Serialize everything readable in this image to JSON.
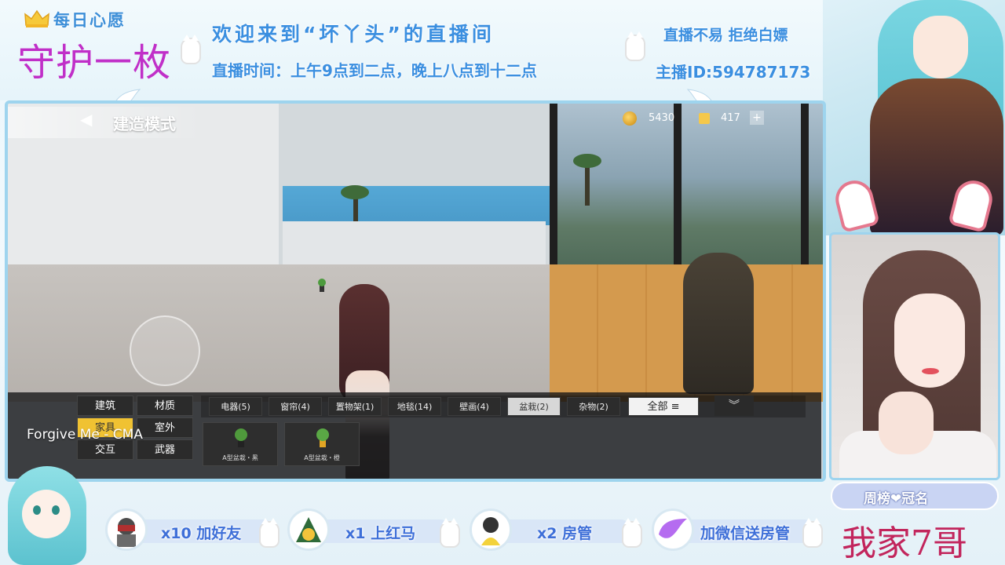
{
  "overlay": {
    "wish_title": "每日心愿",
    "wish_value": "守护一枚",
    "welcome": "欢迎来到“坏丫头”的直播间",
    "schedule": "直播时间：上午9点到二点，晚上八点到十二点",
    "motto": "直播不易 拒绝白嫖",
    "streamer_id": "主播ID:594787173",
    "ranking_label": "周榜❤冠名",
    "sponsor": "我家7哥",
    "music_overlay": "Forgive Me - CMA"
  },
  "game": {
    "mode_title": "建造模式",
    "coins": "5430",
    "tickets": "417",
    "add_symbol": "+",
    "categories": [
      "建筑",
      "材质",
      "家具",
      "室外",
      "交互",
      "武器"
    ],
    "active_category": "家具",
    "sub_tabs": [
      "电器(5)",
      "窗帘(4)",
      "置物架(1)",
      "地毯(14)",
      "壁画(4)",
      "盆栽(2)",
      "杂物(2)"
    ],
    "active_sub_tab": "盆栽(2)",
    "all_label": "全部",
    "items": [
      "A型盆栽・黑",
      "A型盆栽・橙"
    ]
  },
  "gifts": [
    {
      "text": "x10 加好友"
    },
    {
      "text": "x1 上红马"
    },
    {
      "text": "x2 房管"
    },
    {
      "text": "加微信送房管"
    }
  ],
  "colors": {
    "accent_blue": "#3b8fe0",
    "wish_purple": "#c02fc8",
    "sponsor_red": "#c2255c",
    "active_yellow": "#f0c232",
    "frame_blue": "#9ed4ee"
  }
}
